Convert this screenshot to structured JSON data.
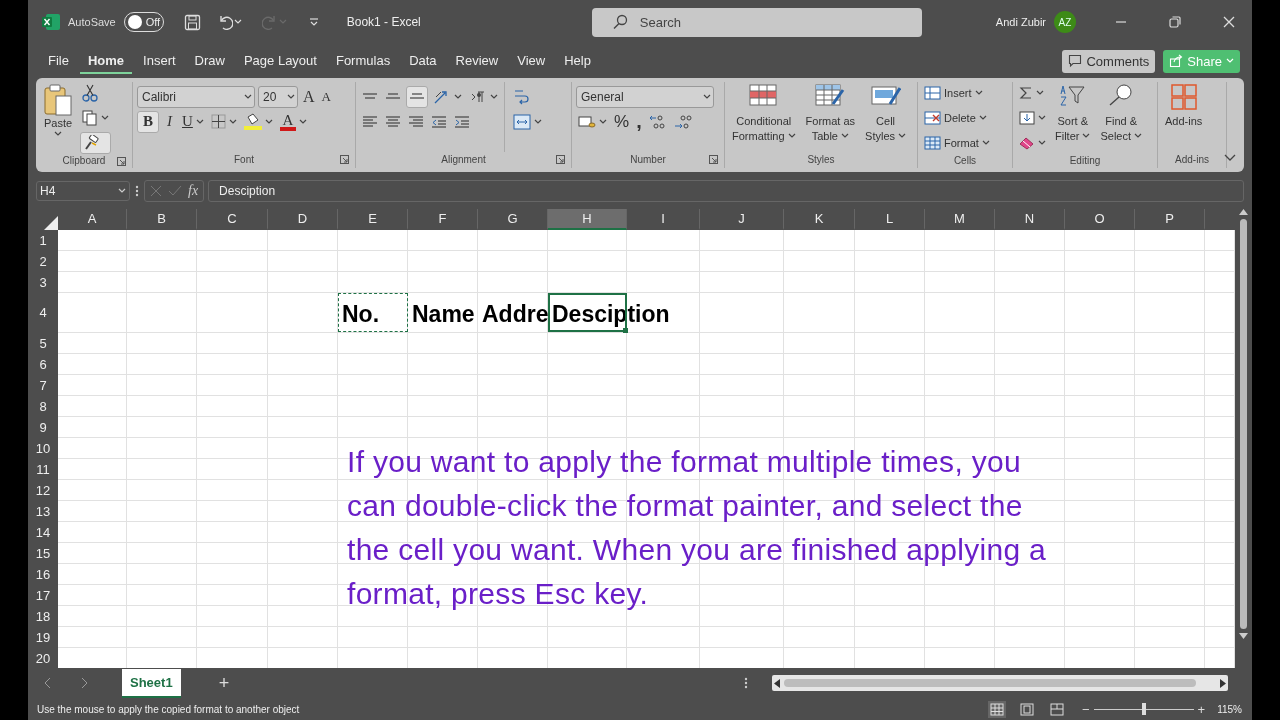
{
  "title_bar": {
    "autosave_label": "AutoSave",
    "autosave": {
      "on": false,
      "label": "Off"
    },
    "redo_disabled": true,
    "document_title": "Book1  -  Excel",
    "search": {
      "placeholder": "Search"
    },
    "user_name": "Andi Zubir",
    "avatar_initials": "AZ"
  },
  "menu_tabs": [
    {
      "label": "File",
      "selected": false
    },
    {
      "label": "Home",
      "selected": true
    },
    {
      "label": "Insert",
      "selected": false
    },
    {
      "label": "Draw",
      "selected": false
    },
    {
      "label": "Page Layout",
      "selected": false
    },
    {
      "label": "Formulas",
      "selected": false
    },
    {
      "label": "Data",
      "selected": false
    },
    {
      "label": "Review",
      "selected": false
    },
    {
      "label": "View",
      "selected": false
    },
    {
      "label": "Help",
      "selected": false
    }
  ],
  "action_buttons": [
    {
      "label": "Comments",
      "kind": "comments"
    },
    {
      "label": "Share",
      "kind": "share"
    }
  ],
  "ribbon": {
    "clipboard": {
      "label": "Clipboard",
      "paste": "Paste",
      "format_painter_on": true
    },
    "font": {
      "label": "Font",
      "font_name": "Calibri",
      "font_size": "20",
      "grow_glyph": "A",
      "shrink_glyph": "A",
      "bold_glyph": "B",
      "bold_on": true,
      "italic_glyph": "I",
      "underline_glyph": "U",
      "font_color_glyph": "A"
    },
    "alignment": {
      "label": "Alignment",
      "bottom_align_on": true
    },
    "number": {
      "label": "Number",
      "format": "General",
      "percent_glyph": "%",
      "comma_glyph": ","
    },
    "styles": {
      "label": "Styles",
      "buttons": [
        {
          "lines": [
            "Conditional",
            "Formatting"
          ]
        },
        {
          "lines": [
            "Format as",
            "Table"
          ]
        },
        {
          "lines": [
            "Cell",
            "Styles"
          ]
        }
      ]
    },
    "cells": {
      "label": "Cells",
      "buttons": [
        "Insert",
        "Delete",
        "Format"
      ]
    },
    "editing": {
      "label": "Editing",
      "buttons": [
        {
          "lines": [
            "Sort &",
            "Filter"
          ]
        },
        {
          "lines": [
            "Find &",
            "Select"
          ]
        }
      ]
    },
    "addins": {
      "label": "Add-ins",
      "button": "Add-ins"
    }
  },
  "formula_bar": {
    "name_box": "H4",
    "function_glyph": "fx",
    "formula": "Desciption"
  },
  "sheet": {
    "columns": [
      {
        "label": "A",
        "selected": false
      },
      {
        "label": "B",
        "selected": false
      },
      {
        "label": "C",
        "selected": false
      },
      {
        "label": "D",
        "selected": false
      },
      {
        "label": "E",
        "selected": false
      },
      {
        "label": "F",
        "selected": false
      },
      {
        "label": "G",
        "selected": false
      },
      {
        "label": "H",
        "selected": true
      },
      {
        "label": "I",
        "selected": false
      },
      {
        "label": "J",
        "selected": false
      },
      {
        "label": "K",
        "selected": false
      },
      {
        "label": "L",
        "selected": false
      },
      {
        "label": "M",
        "selected": false
      },
      {
        "label": "N",
        "selected": false
      },
      {
        "label": "O",
        "selected": false
      },
      {
        "label": "P",
        "selected": false
      }
    ],
    "rows": [
      {
        "label": "1"
      },
      {
        "label": "2"
      },
      {
        "label": "3"
      },
      {
        "label": "4",
        "cells": [
          {
            "text": "No.",
            "kind": "copied"
          },
          {
            "text": "Name",
            "kind": "plain"
          },
          {
            "text": "Addre",
            "kind": "plain"
          },
          {
            "text": "Desciption",
            "kind": "active"
          }
        ]
      },
      {
        "label": "5"
      },
      {
        "label": "6"
      },
      {
        "label": "7"
      },
      {
        "label": "8"
      },
      {
        "label": "9"
      },
      {
        "label": "10"
      },
      {
        "label": "11"
      },
      {
        "label": "12"
      },
      {
        "label": "13"
      },
      {
        "label": "14"
      },
      {
        "label": "15"
      },
      {
        "label": "16"
      },
      {
        "label": "17"
      },
      {
        "label": "18"
      },
      {
        "label": "19"
      },
      {
        "label": "20"
      }
    ]
  },
  "caption_lines": [
    "If you want to apply the format multiple times, you",
    "can double-click the format painter, and select the",
    "the cell you want. When you are finished applying a",
    "format, press Esc key."
  ],
  "sheet_tabs": [
    {
      "label": "Sheet1",
      "selected": true
    }
  ],
  "new_sheet_glyph": "+",
  "status_bar": {
    "text": "Use the mouse to apply the copied format to another object",
    "view_buttons": [
      {
        "selected": true
      },
      {
        "selected": false
      },
      {
        "selected": false
      }
    ],
    "zoom_out": "−",
    "zoom_in": "+",
    "zoom_slider": {
      "level": 0.5
    },
    "zoom": "115%"
  }
}
